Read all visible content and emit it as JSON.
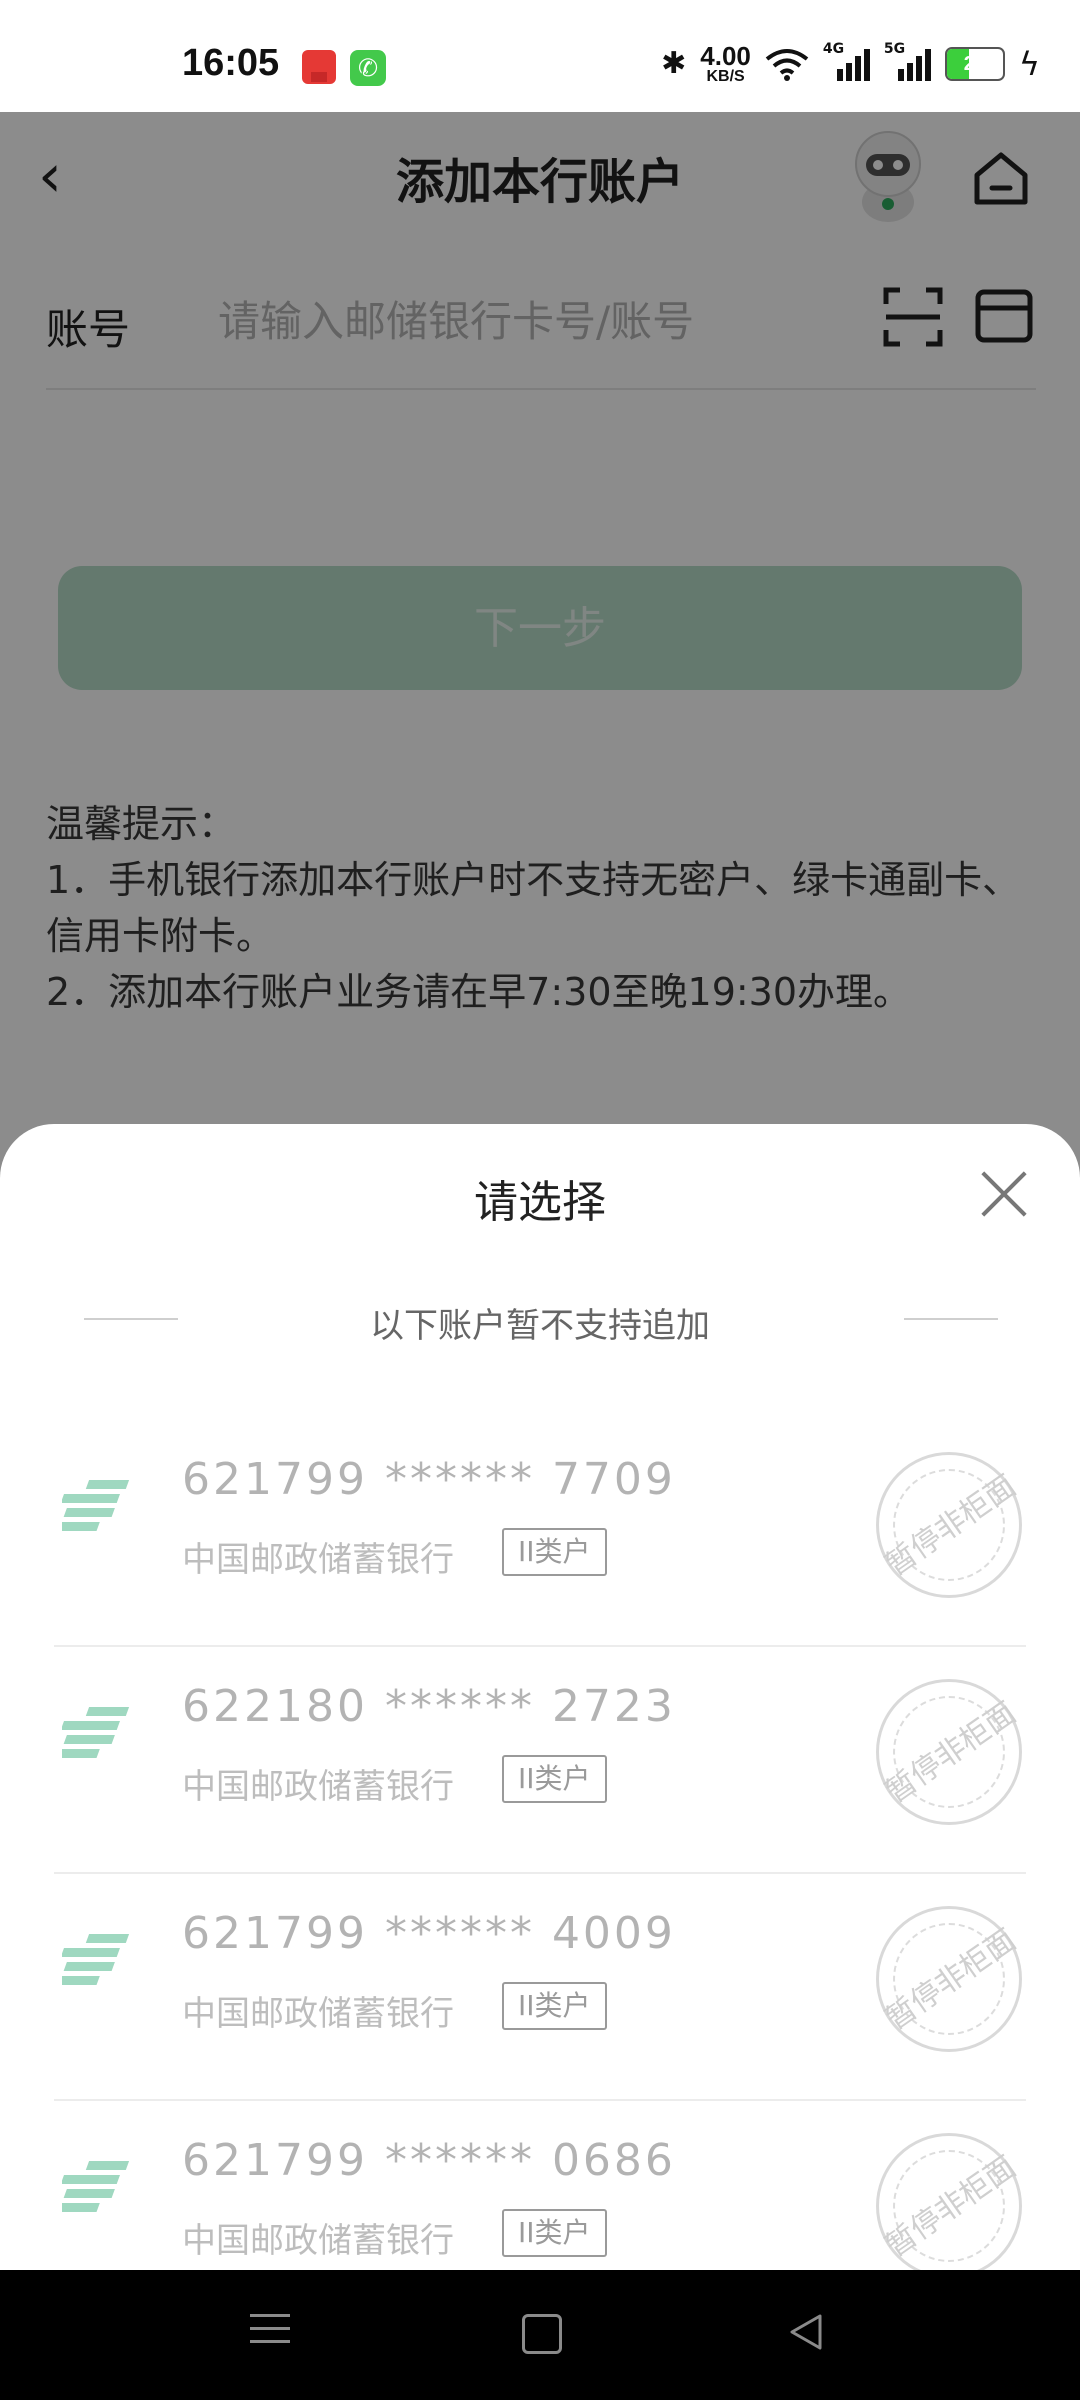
{
  "status_bar": {
    "time": "16:05",
    "speed_value": "4.00",
    "speed_unit": "KB/S",
    "network_1": "4G",
    "network_2": "5G",
    "battery": "29"
  },
  "header": {
    "title": "添加本行账户"
  },
  "form": {
    "account_label": "账号",
    "account_placeholder": "请输入邮储银行卡号/账号",
    "next_button": "下一步"
  },
  "tips": {
    "title": "温馨提示：",
    "line1": "1．手机银行添加本行账户时不支持无密户、绿卡通副卡、信用卡附卡。",
    "line2": "2．添加本行账户业务请在早7:30至晚19:30办理。"
  },
  "sheet": {
    "title": "请选择",
    "subtitle": "以下账户暂不支持追加",
    "accounts": [
      {
        "number": "621799 ****** 7709",
        "bank": "中国邮政储蓄银行",
        "type": "II类户",
        "stamp": "暂停非柜面"
      },
      {
        "number": "622180 ****** 2723",
        "bank": "中国邮政储蓄银行",
        "type": "II类户",
        "stamp": "暂停非柜面"
      },
      {
        "number": "621799 ****** 4009",
        "bank": "中国邮政储蓄银行",
        "type": "II类户",
        "stamp": "暂停非柜面"
      },
      {
        "number": "621799 ****** 0686",
        "bank": "中国邮政储蓄银行",
        "type": "II类户",
        "stamp": "暂停非柜面"
      }
    ]
  },
  "colors": {
    "brand_green": "#1e9b5a",
    "disabled_button": "#b7dcc9",
    "logo_green": "#8fd3b6"
  }
}
